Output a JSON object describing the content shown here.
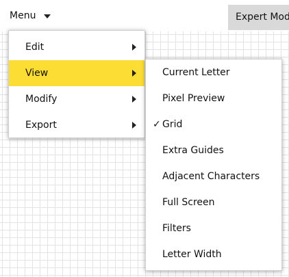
{
  "toolbar": {
    "menu_label": "Menu",
    "expert_label": "Expert Mode"
  },
  "main_menu": {
    "items": [
      {
        "label": "Edit"
      },
      {
        "label": "View"
      },
      {
        "label": "Modify"
      },
      {
        "label": "Export"
      }
    ],
    "active_item": "View"
  },
  "view_submenu": {
    "items": [
      {
        "label": "Current Letter",
        "checked": false
      },
      {
        "label": "Pixel Preview",
        "checked": false
      },
      {
        "label": "Grid",
        "checked": true
      },
      {
        "label": "Extra Guides",
        "checked": false
      },
      {
        "label": "Adjacent Characters",
        "checked": false
      },
      {
        "label": "Full Screen",
        "checked": false
      },
      {
        "label": "Filters",
        "checked": false
      },
      {
        "label": "Letter Width",
        "checked": false
      }
    ],
    "check_glyph": "✓"
  },
  "icons": {
    "menu_caret": "chevron-down-icon",
    "submenu_arrow": "chevron-right-icon",
    "check": "checkmark-icon"
  },
  "colors": {
    "highlight": "#fbdd34",
    "grid_line": "#e3e3e3",
    "button_bg": "#d9d9d9"
  }
}
